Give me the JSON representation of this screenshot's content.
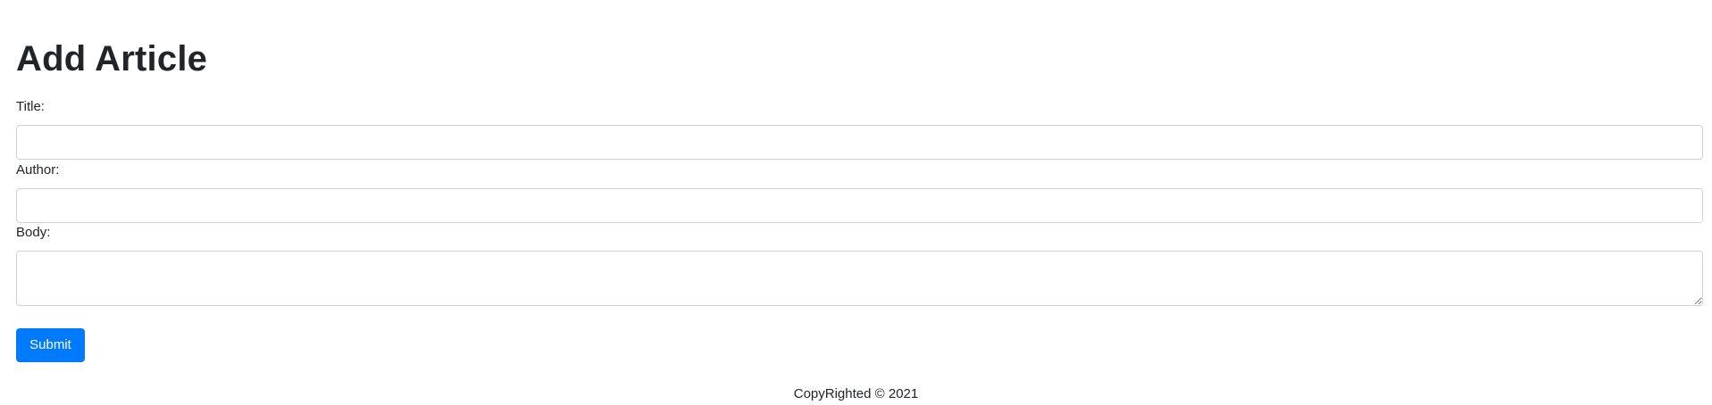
{
  "page": {
    "title": "Add Article"
  },
  "form": {
    "title_label": "Title:",
    "title_value": "",
    "author_label": "Author:",
    "author_value": "",
    "body_label": "Body:",
    "body_value": "",
    "submit_label": "Submit"
  },
  "footer": {
    "text": "CopyRighted © 2021"
  },
  "colors": {
    "primary": "#007bff",
    "text": "#212529",
    "border": "#ced4da"
  }
}
